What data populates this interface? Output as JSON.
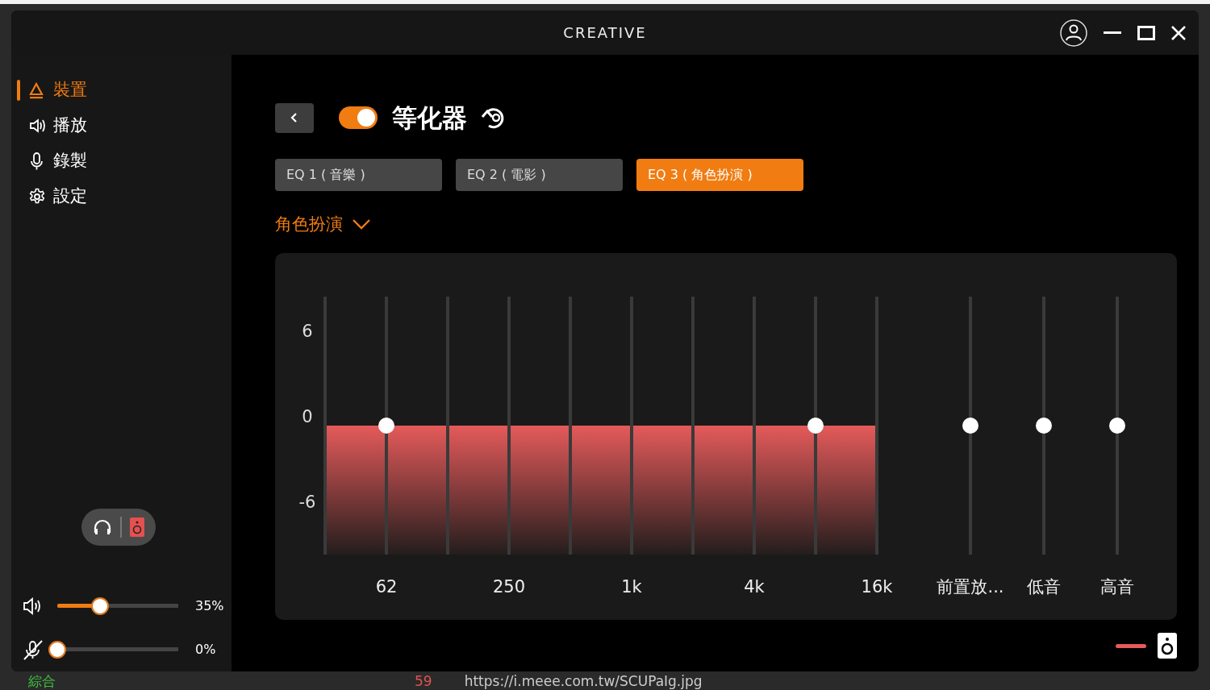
{
  "window": {
    "logo": "CREATIVE"
  },
  "sidebar": {
    "items": [
      {
        "label": "裝置",
        "selected": true
      },
      {
        "label": "播放",
        "selected": false
      },
      {
        "label": "錄製",
        "selected": false
      },
      {
        "label": "設定",
        "selected": false
      }
    ]
  },
  "output_switch": [
    {
      "kind": "headphones",
      "selected": false
    },
    {
      "kind": "speaker",
      "selected": true
    }
  ],
  "volume": {
    "level": 0.35,
    "reading": "35%",
    "muted": false
  },
  "mic": {
    "level": 0,
    "reading": "0%",
    "muted": true
  },
  "equalizer": {
    "title": "等化器",
    "on": true,
    "presets": [
      {
        "label": "EQ 1 ( 音樂 )",
        "selected": false
      },
      {
        "label": "EQ 2 ( 電影 )",
        "selected": false
      },
      {
        "label": "EQ 3 ( 角色扮演 )",
        "selected": true
      }
    ],
    "profile": "角色扮演",
    "y_labels": [
      "6",
      "0",
      "-6"
    ],
    "bands": [
      {
        "handle": false
      },
      {
        "label": "62",
        "handle": true,
        "level": 0.5
      },
      {
        "handle": false
      },
      {
        "label": "250",
        "handle": false
      },
      {
        "handle": false
      },
      {
        "label": "1k",
        "handle": false
      },
      {
        "handle": false
      },
      {
        "label": "4k",
        "handle": false
      },
      {
        "handle": true,
        "level": 0.5
      },
      {
        "label": "16k",
        "handle": false
      }
    ],
    "extras": [
      {
        "label": "前置放...",
        "level": 0.5
      },
      {
        "label": "低音",
        "level": 0.5
      },
      {
        "label": "高音",
        "level": 0.5
      }
    ]
  },
  "background": {
    "tag": "綜合",
    "line_number": "59",
    "url": "https://i.meee.com.tw/SCUPaIg.jpg"
  }
}
